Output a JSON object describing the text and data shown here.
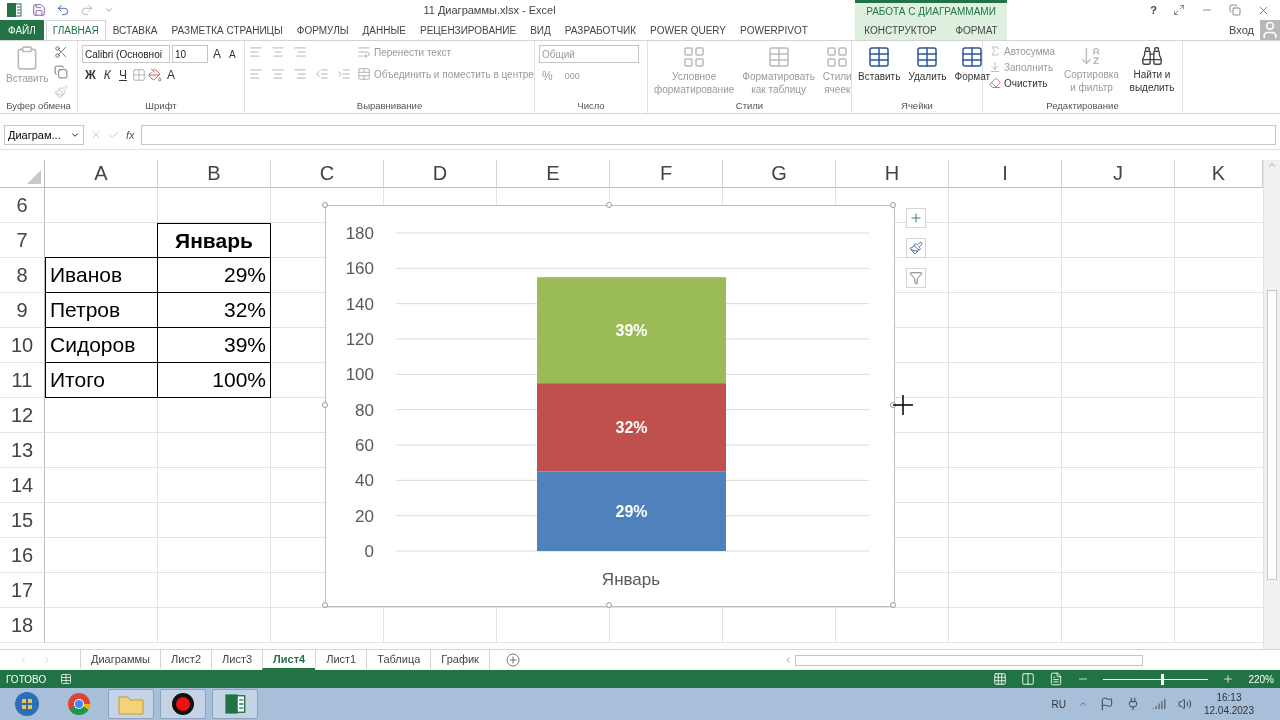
{
  "title_bar": {
    "title": "11 Диаграммы.xlsx - Excel",
    "context_label": "РАБОТА С ДИАГРАММАМИ",
    "help": "?"
  },
  "tabs": [
    {
      "label": "ФАЙЛ",
      "kind": "file",
      "selected": false
    },
    {
      "label": "ГЛАВНАЯ",
      "kind": "main",
      "selected": true
    },
    {
      "label": "ВСТАВКА",
      "kind": "main",
      "selected": false
    },
    {
      "label": "РАЗМЕТКА СТРАНИЦЫ",
      "kind": "main",
      "selected": false
    },
    {
      "label": "ФОРМУЛЫ",
      "kind": "main",
      "selected": false
    },
    {
      "label": "ДАННЫЕ",
      "kind": "main",
      "selected": false
    },
    {
      "label": "РЕЦЕНЗИРОВАНИЕ",
      "kind": "main",
      "selected": false
    },
    {
      "label": "ВИД",
      "kind": "main",
      "selected": false
    },
    {
      "label": "РАЗРАБОТЧИК",
      "kind": "main",
      "selected": false
    },
    {
      "label": "POWER QUERY",
      "kind": "main",
      "selected": false
    },
    {
      "label": "POWERPIVOT",
      "kind": "main",
      "selected": false
    },
    {
      "label": "КОНСТРУКТОР",
      "kind": "context",
      "selected": false
    },
    {
      "label": "ФОРМАТ",
      "kind": "context",
      "selected": false
    }
  ],
  "sign_in": "Вход",
  "ribbon": {
    "clipboard": {
      "name": "Буфер обмена",
      "paste": {
        "label": "Вставить",
        "disabled": true
      }
    },
    "font": {
      "name": "Шрифт",
      "family": "Calibri (Основноі",
      "size": "10",
      "styles": [
        "Ж",
        "К",
        "Ч"
      ],
      "grow": "A",
      "shrink": "A",
      "font_color_label": "A"
    },
    "alignment": {
      "name": "Выравнивание",
      "wrap": {
        "label": "Перенести текст",
        "disabled": true
      },
      "merge": {
        "label": "Объединить и поместить в центре",
        "disabled": true
      }
    },
    "number": {
      "name": "Число",
      "format": "Общий",
      "percent": "%",
      "thousands": "000",
      "disabled": true
    },
    "styles": {
      "name": "Стили",
      "items": [
        {
          "label": "Условное форматирование",
          "disabled": true
        },
        {
          "label": "Форматировать как таблицу",
          "disabled": true
        },
        {
          "label": "Стили ячеек",
          "disabled": true
        }
      ]
    },
    "cells": {
      "name": "Ячейки",
      "items": [
        {
          "label": "Вставить",
          "disabled": false
        },
        {
          "label": "Удалить",
          "disabled": false
        },
        {
          "label": "Формат",
          "disabled": false
        }
      ]
    },
    "editing": {
      "name": "Редактирование",
      "small": [
        {
          "label": "Автосумма",
          "disabled": true
        },
        {
          "label": "Заполнить",
          "disabled": true
        },
        {
          "label": "Очистить",
          "disabled": false
        }
      ],
      "large": [
        {
          "label": "Сортировка и фильтр",
          "disabled": true
        },
        {
          "label": "Найти и выделить",
          "disabled": false
        }
      ]
    }
  },
  "formula_bar": {
    "name_box": "Диаграм...",
    "fx": "fx"
  },
  "sheet": {
    "columns": [
      "A",
      "B",
      "C",
      "D",
      "E",
      "F",
      "G",
      "H",
      "I",
      "J",
      "K"
    ],
    "rows": [
      "6",
      "7",
      "8",
      "9",
      "10",
      "11",
      "12",
      "13",
      "14",
      "15",
      "16",
      "17",
      "18"
    ],
    "table": {
      "header": "Январь",
      "rows": [
        {
          "name": "Иванов",
          "value": "29%"
        },
        {
          "name": "Петров",
          "value": "32%"
        },
        {
          "name": "Сидоров",
          "value": "39%"
        },
        {
          "name": "Итого",
          "value": "100%"
        }
      ]
    }
  },
  "chart": {
    "chart_data": {
      "type": "bar",
      "categories": [
        "Январь"
      ],
      "orientation": "vertical",
      "stacked": true,
      "grid": true,
      "ylim": [
        0,
        180
      ],
      "yticks": [
        0,
        20,
        40,
        60,
        80,
        100,
        120,
        140,
        160,
        180
      ],
      "series": [
        {
          "color": "#4f81bd",
          "values": [
            45
          ]
        },
        {
          "color": "#c0504d",
          "values": [
            50
          ]
        },
        {
          "color": "#9bbb59",
          "values": [
            60
          ]
        }
      ],
      "value_labels": [
        "29%",
        "32%",
        "39%"
      ]
    }
  },
  "sheet_tabs": [
    {
      "label": "Диаграммы",
      "selected": false
    },
    {
      "label": "Лист2",
      "selected": false
    },
    {
      "label": "Лист3",
      "selected": false
    },
    {
      "label": "Лист4",
      "selected": true
    },
    {
      "label": "Лист1",
      "selected": false
    },
    {
      "label": "Таблица",
      "selected": false
    },
    {
      "label": "График",
      "selected": false
    }
  ],
  "status_bar": {
    "status": "ГОТОВО",
    "zoom": {
      "level": 0.55,
      "reading": "220%"
    }
  },
  "taskbar": {
    "language": "RU",
    "time": "16:13",
    "date": "12.04.2023"
  }
}
